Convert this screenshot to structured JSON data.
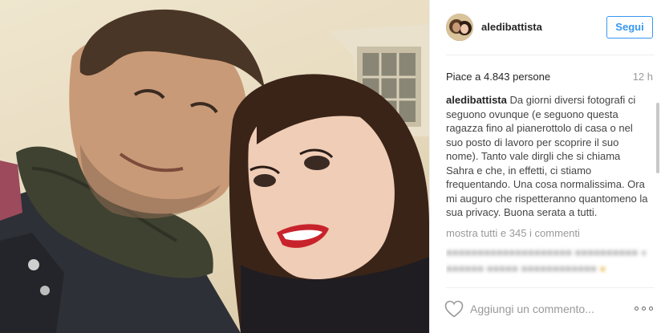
{
  "post": {
    "photo_icon": "couple-selfie-photo"
  },
  "header": {
    "username": "aledibattista",
    "follow_label": "Segui"
  },
  "stats": {
    "likes": "Piace a 4.843 persone",
    "time": "12 h"
  },
  "caption": {
    "user": "aledibattista",
    "text": "Da giorni diversi fotografi ci seguono ovunque (e seguono questa ragazza fino al pianerottolo di casa o nel suo posto di lavoro per scoprire il suo nome). Tanto vale dirgli che si chiama Sahra e che, in effetti, ci stiamo frequentando. Una cosa normalissima. Ora mi auguro che rispetteranno quantomeno la sua privacy. Buona serata a tutti."
  },
  "comments": {
    "show_all": "mostra tutti e 345 i commenti"
  },
  "footer": {
    "comment_placeholder": "Aggiungi un commento...",
    "like_icon": "heart-icon",
    "more_icon": "more-options-icon"
  },
  "colors": {
    "accent": "#3897f0",
    "muted": "#999999",
    "text": "#262626"
  }
}
